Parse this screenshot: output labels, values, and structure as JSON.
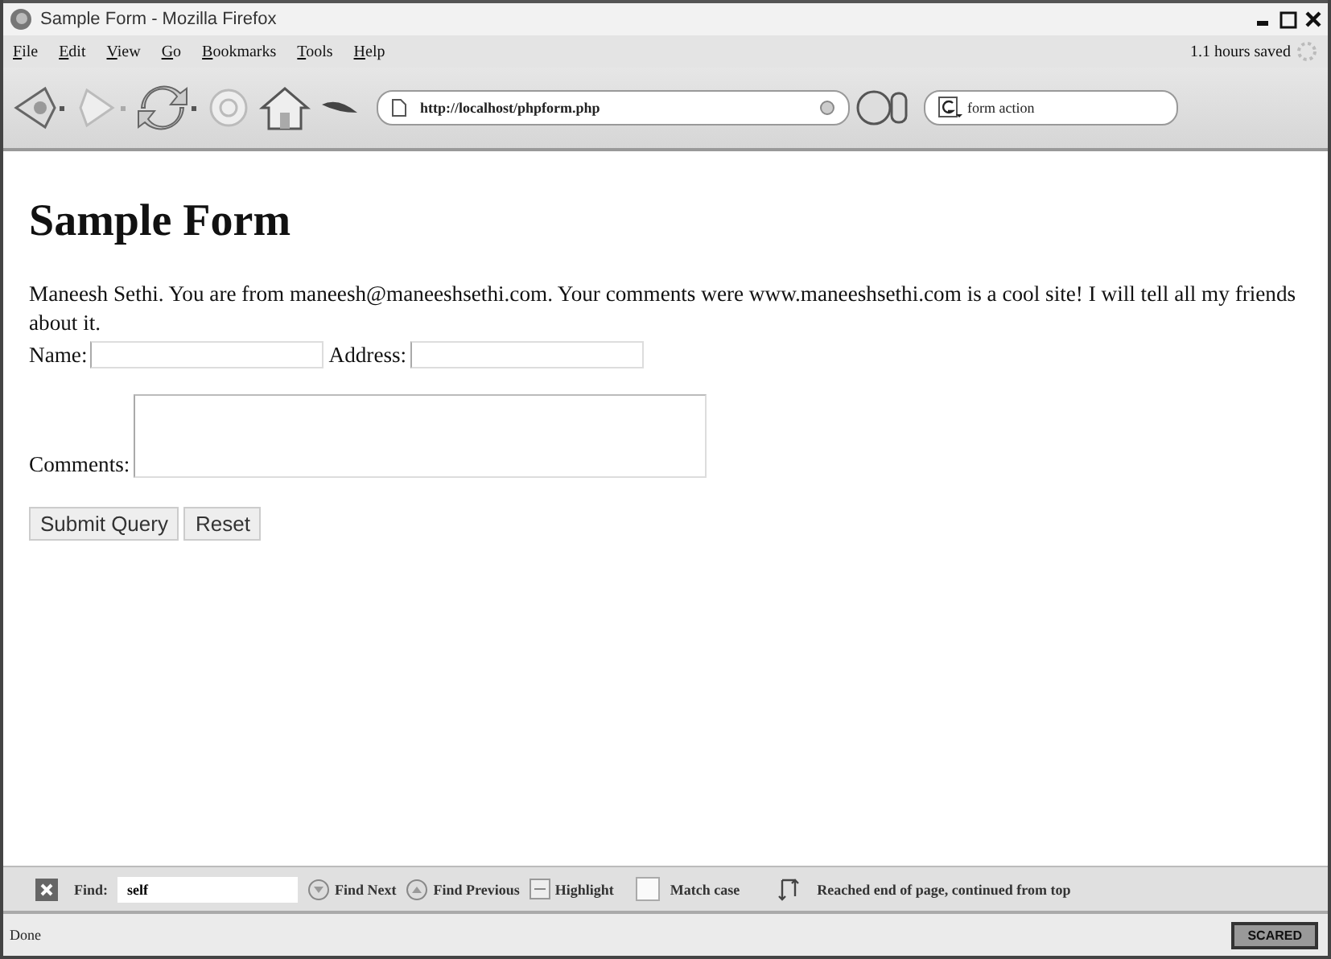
{
  "window": {
    "title": "Sample Form - Mozilla Firefox"
  },
  "menu": {
    "items": [
      {
        "label": "File"
      },
      {
        "label": "Edit"
      },
      {
        "label": "View"
      },
      {
        "label": "Go"
      },
      {
        "label": "Bookmarks"
      },
      {
        "label": "Tools"
      },
      {
        "label": "Help"
      }
    ],
    "extension_text": "1.1 hours saved"
  },
  "toolbar": {
    "url": "http://localhost/phpform.php",
    "search": "form action"
  },
  "page": {
    "heading": "Sample Form",
    "message": "Maneesh Sethi. You are from maneesh@maneeshsethi.com. Your comments were www.maneeshsethi.com is a cool site! I will tell all my friends about it.",
    "fields": {
      "name_label": "Name:",
      "address_label": "Address:",
      "comments_label": "Comments:"
    },
    "buttons": [
      "Submit Query",
      "Reset"
    ]
  },
  "find_bar": {
    "label": "Find:",
    "value": "self",
    "find_next": "Find Next",
    "find_previous": "Find Previous",
    "highlight": "Highlight",
    "match_case": {
      "label": "Match case",
      "checked": false
    },
    "message": "Reached end of page, continued from top"
  },
  "status_bar": {
    "text": "Done",
    "badge": "SCARED"
  }
}
